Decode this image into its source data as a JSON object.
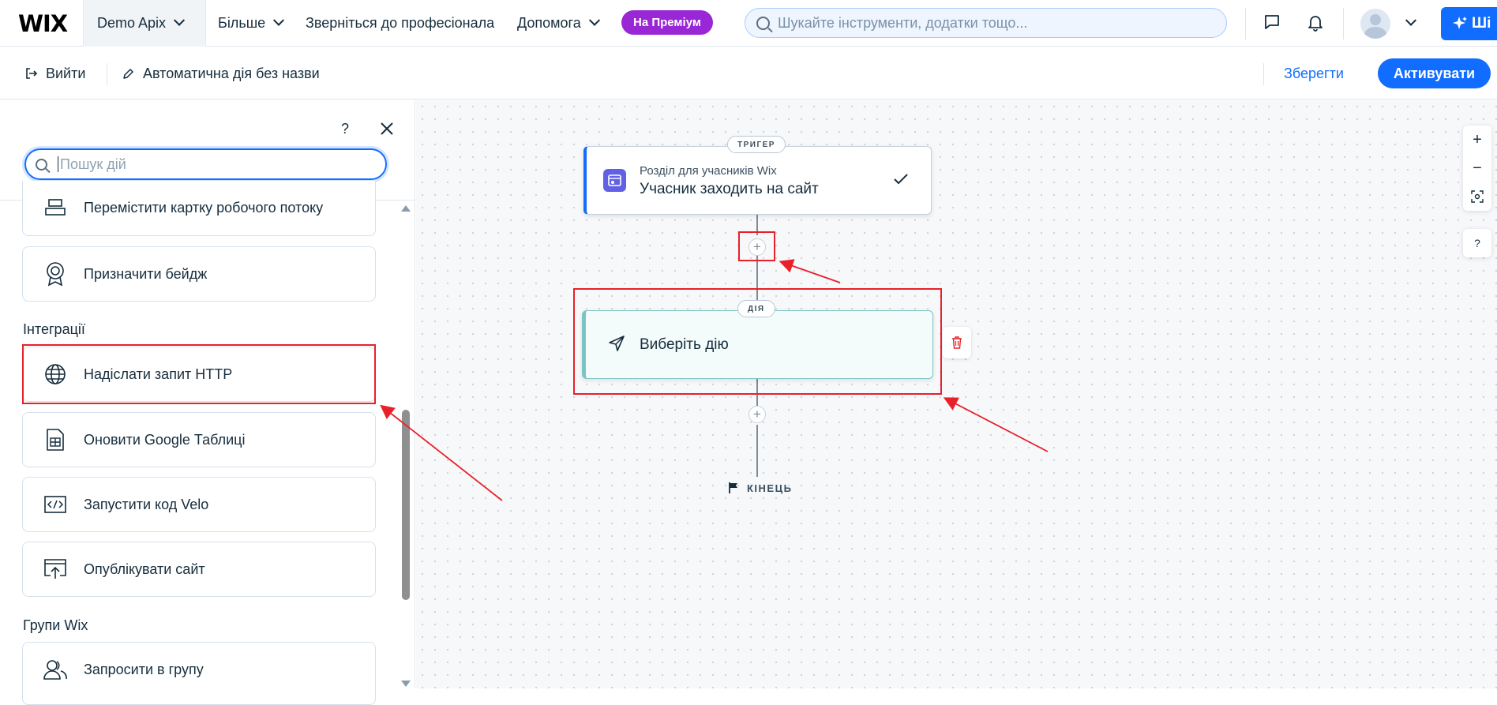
{
  "topbar": {
    "logo": "WIX",
    "site_name": "Demo Apix",
    "nav": [
      "Більше",
      "Зверніться до професіонала",
      "Допомога"
    ],
    "premium_label": "На Преміум",
    "search_placeholder": "Шукайте інструменти, додатки тощо...",
    "ai_label": "Ші"
  },
  "toolbar": {
    "exit_label": "Вийти",
    "automation_name": "Автоматична дія без назви",
    "save_label": "Зберегти",
    "activate_label": "Активувати"
  },
  "sidebar": {
    "help_label": "?",
    "search_placeholder": "Пошук дій",
    "items_top": [
      {
        "label": "Перемістити картку робочого потоку",
        "icon": "workflow-card-icon"
      },
      {
        "label": "Призначити бейдж",
        "icon": "badge-icon"
      }
    ],
    "section_integrations": "Інтеграції",
    "integrations": [
      {
        "label": "Надіслати запит HTTP",
        "icon": "globe-icon"
      },
      {
        "label": "Оновити Google Таблиці",
        "icon": "spreadsheet-icon"
      },
      {
        "label": "Запустити код Velo",
        "icon": "code-icon"
      },
      {
        "label": "Опублікувати сайт",
        "icon": "publish-icon"
      }
    ],
    "section_groups": "Групи Wix",
    "groups": [
      {
        "label": "Запросити в групу",
        "icon": "group-icon"
      }
    ]
  },
  "canvas": {
    "trigger_pill": "ТРИГЕР",
    "trigger_app": "Розділ для учасників Wix",
    "trigger_title": "Учасник заходить на сайт",
    "action_pill": "ДІЯ",
    "action_title": "Виберіть дію",
    "end_label": "КІНЕЦЬ",
    "zoom_in": "+",
    "zoom_out": "−",
    "help_label": "?"
  },
  "colors": {
    "accent": "#116dff",
    "premium": "#9a27d5",
    "trigger_accent": "#116dff",
    "action_accent": "#3aa5a4",
    "highlight": "#e8202a"
  }
}
